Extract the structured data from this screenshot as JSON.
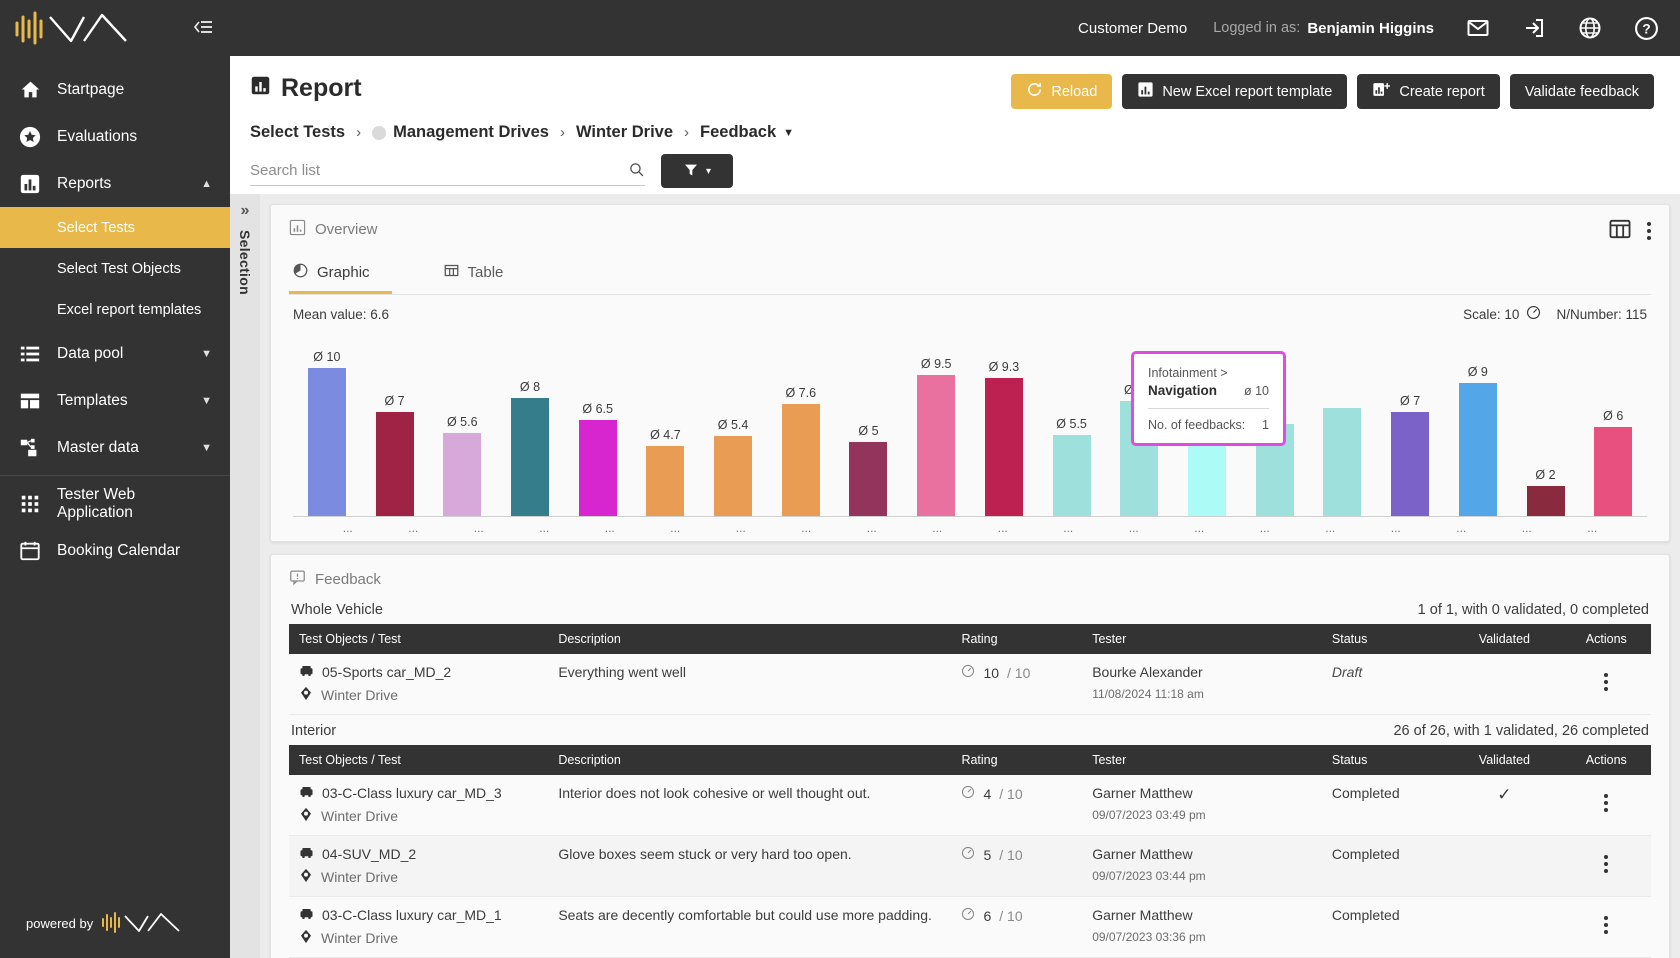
{
  "sidebar": {
    "logo_alt": "company-logo",
    "collapse_icon": "collapse-sidebar-icon",
    "items": [
      {
        "label": "Startpage",
        "icon": "home-icon",
        "expandable": false
      },
      {
        "label": "Evaluations",
        "icon": "star-icon",
        "expandable": false
      },
      {
        "label": "Reports",
        "icon": "bar-chart-icon",
        "expandable": true,
        "expanded": true
      },
      {
        "label": "Data pool",
        "icon": "list-icon",
        "expandable": true,
        "expanded": false
      },
      {
        "label": "Templates",
        "icon": "template-icon",
        "expandable": true,
        "expanded": false
      },
      {
        "label": "Master data",
        "icon": "hierarchy-icon",
        "expandable": true,
        "expanded": false
      },
      {
        "label": "Tester Web Application",
        "icon": "grid-icon",
        "expandable": false
      },
      {
        "label": "Booking Calendar",
        "icon": "calendar-icon",
        "expandable": false
      }
    ],
    "sub_items": [
      {
        "label": "Select Tests",
        "active": true
      },
      {
        "label": "Select Test Objects",
        "active": false
      },
      {
        "label": "Excel report templates",
        "active": false
      }
    ],
    "footer": {
      "powered_by": "powered by"
    }
  },
  "topbar": {
    "customer": "Customer Demo",
    "logged_in_label": "Logged in as:",
    "user": "Benjamin Higgins",
    "icons": [
      "mail-icon",
      "logout-icon",
      "globe-icon",
      "help-icon"
    ]
  },
  "header": {
    "title": "Report",
    "title_icon": "report-chart-icon",
    "buttons": [
      {
        "label": "Reload",
        "icon": "refresh-icon",
        "style": "amber"
      },
      {
        "label": "New Excel report template",
        "icon": "excel-chart-icon",
        "style": "dark"
      },
      {
        "label": "Create report",
        "icon": "chart-plus-icon",
        "style": "dark"
      },
      {
        "label": "Validate feedback",
        "icon": "",
        "style": "dark"
      }
    ],
    "breadcrumb": [
      {
        "label": "Select Tests",
        "dot": false,
        "caret": false
      },
      {
        "label": "Management Drives",
        "dot": true,
        "caret": false
      },
      {
        "label": "Winter Drive",
        "dot": false,
        "caret": false
      },
      {
        "label": "Feedback",
        "dot": false,
        "caret": true
      }
    ],
    "breadcrumb_separator": "›"
  },
  "search": {
    "placeholder": "Search list",
    "value": "",
    "search_icon": "search-icon",
    "filter_icon": "filter-icon",
    "filter_caret": "▾"
  },
  "selection_rail": {
    "label": "Selection",
    "expand_icon": "chevron-double-right-icon"
  },
  "overview": {
    "title": "Overview",
    "title_icon": "bar-chart-icon",
    "tools": [
      "table-columns-icon",
      "kebab-menu-icon"
    ],
    "tabs": [
      {
        "label": "Graphic",
        "icon": "pie-chart-icon",
        "active": true
      },
      {
        "label": "Table",
        "icon": "table-icon",
        "active": false
      }
    ],
    "mean_label": "Mean value: 6.6",
    "scale_label": "Scale: 10",
    "scale_icon": "gauge-icon",
    "nnumber_label": "N/Number: 115"
  },
  "chart_data": {
    "type": "bar",
    "title": "Overview",
    "xlabel": "",
    "ylabel": "",
    "ylim": [
      0,
      10
    ],
    "grid": false,
    "legend": "none",
    "value_prefix": "Ø ",
    "tick_label": "...",
    "categories": [
      "...",
      "...",
      "...",
      "...",
      "...",
      "...",
      "...",
      "...",
      "...",
      "...",
      "...",
      "...",
      "...",
      "...",
      "...",
      "...",
      "...",
      "...",
      "...",
      "..."
    ],
    "values": [
      10,
      7,
      5.6,
      8,
      6.5,
      4.7,
      5.4,
      7.6,
      5,
      9.5,
      9.3,
      5.5,
      7.8,
      10,
      6.2,
      7.3,
      7,
      9,
      2,
      6
    ],
    "value_labels": [
      "Ø 10",
      "Ø 7",
      "Ø 5.6",
      "Ø 8",
      "Ø 6.5",
      "Ø 4.7",
      "Ø 5.4",
      "Ø 7.6",
      "Ø 5",
      "Ø 9.5",
      "Ø 9.3",
      "Ø 5.5",
      "Ø 7.8",
      "Ø 10",
      "",
      "",
      "Ø 7",
      "Ø 9",
      "Ø 2",
      "Ø 6"
    ],
    "colors": [
      "#7b8be0",
      "#9e2344",
      "#d7a8da",
      "#357d8a",
      "#d726cf",
      "#e89c54",
      "#e89c54",
      "#e89c54",
      "#93345c",
      "#e8719f",
      "#bd2152",
      "#9de0dc",
      "#9de0dc",
      "#adfbf7",
      "#9de0dc",
      "#9de0dc",
      "#7a62c8",
      "#53a7e8",
      "#8a2a3e",
      "#e8507f"
    ]
  },
  "tooltip": {
    "path": "Infotainment >",
    "name": "Navigation",
    "average": "ø 10",
    "feedback_label": "No. of feedbacks:",
    "feedback_count": "1",
    "border_color": "#e24ae2"
  },
  "feedback": {
    "title": "Feedback",
    "title_icon": "feedback-icon",
    "columns": [
      "Test Objects / Test",
      "Description",
      "Rating",
      "Tester",
      "Status",
      "Validated",
      "Actions"
    ],
    "groups": [
      {
        "name": "Whole Vehicle",
        "summary": "1 of 1, with 0 validated, 0 completed",
        "rows": [
          {
            "object": "05-Sports car_MD_2",
            "test": "Winter Drive",
            "description": "Everything went well",
            "rating_value": "10",
            "rating_max": "/ 10",
            "tester": "Bourke Alexander",
            "date": "11/08/2024 11:18 am",
            "status": "Draft",
            "status_style": "draft",
            "validated": "",
            "actions_icon": "kebab-menu-icon"
          }
        ]
      },
      {
        "name": "Interior",
        "summary": "26 of 26, with 1 validated, 26 completed",
        "rows": [
          {
            "object": "03-C-Class luxury car_MD_3",
            "test": "Winter Drive",
            "description": "Interior does not look cohesive or well thought out.",
            "rating_value": "4",
            "rating_max": "/ 10",
            "tester": "Garner Matthew",
            "date": "09/07/2023 03:49 pm",
            "status": "Completed",
            "status_style": "normal",
            "validated": "✓",
            "actions_icon": "kebab-menu-icon"
          },
          {
            "object": "04-SUV_MD_2",
            "test": "Winter Drive",
            "description": "Glove boxes seem stuck or very hard too open.",
            "rating_value": "5",
            "rating_max": "/ 10",
            "tester": "Garner Matthew",
            "date": "09/07/2023 03:44 pm",
            "status": "Completed",
            "status_style": "normal",
            "validated": "",
            "actions_icon": "kebab-menu-icon"
          },
          {
            "object": "03-C-Class luxury car_MD_1",
            "test": "Winter Drive",
            "description": "Seats are decently comfortable but could use more padding.",
            "rating_value": "6",
            "rating_max": "/ 10",
            "tester": "Garner Matthew",
            "date": "09/07/2023 03:36 pm",
            "status": "Completed",
            "status_style": "normal",
            "validated": "",
            "actions_icon": "kebab-menu-icon"
          }
        ]
      }
    ]
  }
}
